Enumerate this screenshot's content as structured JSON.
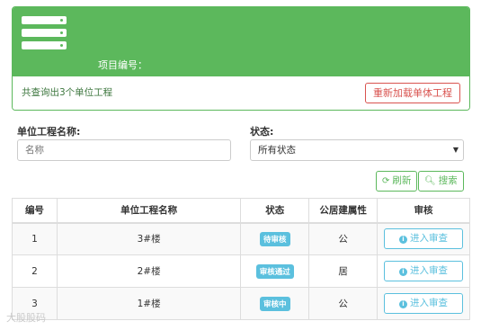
{
  "header": {
    "project_label": "项目编号：",
    "result_text": "共查询出3个单位工程",
    "reload_button": "重新加载单体工程",
    "logo_icon": "server-icon"
  },
  "filters": {
    "name_label": "单位工程名称:",
    "name_placeholder": "名称",
    "status_label": "状态:",
    "status_selected": "所有状态",
    "refresh_label": "刷新",
    "search_label": "搜索"
  },
  "table": {
    "headers": [
      "编号",
      "单位工程名称",
      "状态",
      "公居建属性",
      "审核"
    ],
    "rows": [
      {
        "no": "1",
        "name": "3#楼",
        "status": "待审核",
        "attr": "公",
        "action": "进入审查"
      },
      {
        "no": "2",
        "name": "2#楼",
        "status": "审核通过",
        "attr": "居",
        "action": "进入审查"
      },
      {
        "no": "3",
        "name": "1#楼",
        "status": "审核中",
        "attr": "公",
        "action": "进入审查"
      }
    ]
  },
  "colors": {
    "primary_green": "#5cb85c",
    "danger_red": "#d9534f",
    "info_blue": "#5bc0de"
  },
  "watermark": "大股股码"
}
